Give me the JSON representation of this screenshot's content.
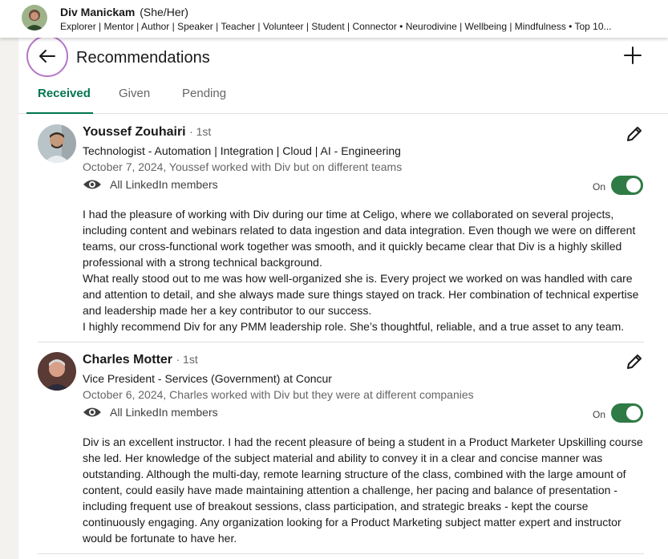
{
  "profile": {
    "name": "Div Manickam",
    "pronouns": "(She/Her)",
    "headline": "Explorer | Mentor | Author | Speaker | Teacher | Volunteer | Student | Connector • Neurodivine | Wellbeing | Mindfulness • Top 10..."
  },
  "page": {
    "title": "Recommendations",
    "back_icon": "arrow-left-icon",
    "add_icon": "plus-icon"
  },
  "tabs": [
    {
      "label": "Received",
      "active": true
    },
    {
      "label": "Given",
      "active": false
    },
    {
      "label": "Pending",
      "active": false
    }
  ],
  "recommendations": [
    {
      "name": "Youssef Zouhairi",
      "degree": "· 1st",
      "title": "Technologist - Automation | Integration | Cloud | AI - Engineering",
      "date": "October 7, 2024, Youssef worked with Div but on different teams",
      "visibility": "All LinkedIn members",
      "toggle_label": "On",
      "toggle_on": true,
      "paragraphs": [
        "I had the pleasure of working with Div during our time at Celigo, where we collaborated on several projects, including content and webinars related to data ingestion and data integration. Even though we were on different teams, our cross-functional work together was smooth, and it quickly became clear that Div is a highly skilled professional with a strong technical background.",
        "What really stood out to me was how well-organized she is. Every project we worked on was handled with care and attention to detail, and she always made sure things stayed on track. Her combination of technical expertise and leadership made her a key contributor to our success.",
        "I highly recommend Div for any PMM leadership role. She’s thoughtful, reliable, and a true asset to any team."
      ]
    },
    {
      "name": "Charles Motter",
      "degree": "· 1st",
      "title": "Vice President - Services (Government) at Concur",
      "date": "October 6, 2024, Charles worked with Div but they were at different companies",
      "visibility": "All LinkedIn members",
      "toggle_label": "On",
      "toggle_on": true,
      "paragraphs": [
        "Div is an excellent instructor. I had the recent pleasure of being a student in a Product Marketer Upskilling course she led. Her knowledge of the subject material and ability to convey it in a clear and concise manner was outstanding. Although the multi-day, remote learning structure of the class, combined with the large amount of content, could easily have made maintaining attention a challenge, her pacing and balance of presentation - including frequent use of breakout sessions, class participation, and strategic breaks - kept the course continuously engaging. Any organization looking for a Product Marketing subject matter expert and instructor would be fortunate to have her."
      ]
    }
  ],
  "colors": {
    "accent_green": "#01754f",
    "toggle_green": "#2f7a45",
    "back_ring": "#b575c8"
  }
}
